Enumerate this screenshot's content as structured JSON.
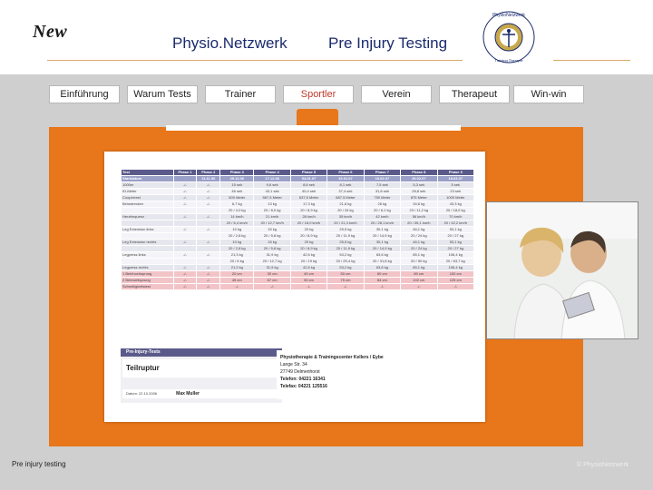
{
  "header": {
    "logo_text": "New",
    "title_left": "Physio.Netzwerk",
    "title_right": "Pre Injury Testing",
    "seal_text": "PhysioNetzwerk Med. Training Therapie"
  },
  "nav": {
    "items": [
      {
        "label": "Einführung",
        "active": false
      },
      {
        "label": "Warum Tests",
        "active": false
      },
      {
        "label": "Trainer",
        "active": false
      },
      {
        "label": "Sportler",
        "active": true
      },
      {
        "label": "Verein",
        "active": false
      },
      {
        "label": "Therapeut",
        "active": false
      },
      {
        "label": "Win-win",
        "active": false
      }
    ]
  },
  "table": {
    "headers": [
      "Test",
      "Phase 1",
      "Phase 2",
      "Phase 3",
      "Phase 4",
      "Phase 5",
      "Phase 6",
      "Phase 7",
      "Phase 8",
      "Phase 9"
    ],
    "rows": [
      {
        "style": "sd",
        "cells": [
          "Startdatum",
          "",
          "11.11.06",
          "29.11.06",
          "17.12.06",
          "04.01.07",
          "23.01.07",
          "10.02.07",
          "28.02.07",
          "18.03.07"
        ]
      },
      {
        "style": "even",
        "cells": [
          "1000er",
          "-/-",
          "-/-",
          "15 sek",
          "9,6 sek",
          "8,6 sek",
          "8,1 sek",
          "7,5 sek",
          "5,3 sek",
          "5 sek"
        ]
      },
      {
        "style": "odd",
        "cells": [
          "ID-Meter",
          "-/-",
          "-/-",
          "46 sek",
          "43,1 sek",
          "40,4 sek",
          "37,4 sek",
          "31,8 sek",
          "28,8 sek",
          "23 sek"
        ]
      },
      {
        "style": "even",
        "cells": [
          "Cooperrest",
          "-/-",
          "-/-",
          "500 Meter",
          "587,5 Meter",
          "637,5 Meter",
          "687,5 Meter",
          "750 Meter",
          "875 Meter",
          "1000 Meter"
        ]
      },
      {
        "style": "odd",
        "cells": [
          "Beinstrecken",
          "-/-",
          "-/-",
          "6,7 kg",
          "13 kg",
          "17,3 kg",
          "21,6 kg",
          "26 kg",
          "34,6 kg",
          "43,3 kg"
        ]
      },
      {
        "style": "odd",
        "cells": [
          "",
          "",
          "",
          "20 / 4,0 kg",
          "20 / 8,0 kg",
          "20 / 8,9 kg",
          "20 / 34 kg",
          "20 / 6,1 kg",
          "23 / 11,2 kg",
          "20 / 18,0 kg"
        ]
      },
      {
        "style": "even",
        "cells": [
          "Herzfrequenz",
          "-/-",
          "-/-",
          "14 km/h",
          "21 km/h",
          "28 km/h",
          "35 km/h",
          "42 km/h",
          "56 km/h",
          "70 km/h"
        ]
      },
      {
        "style": "even",
        "cells": [
          "",
          "",
          "",
          "20 / 6,4 km/h",
          "20 / 12,7 km/h",
          "20 / 18,0 km/h",
          "20 / 21,3 km/h",
          "20 / 28,1 km/h",
          "20 / 35,1 km/h",
          "20 / 42,2 km/h"
        ]
      },
      {
        "style": "odd",
        "cells": [
          "Leg Extension links",
          "-/-",
          "-/-",
          "10 kg",
          "15 kg",
          "20 kg",
          "25,5 kg",
          "30,1 kg",
          "46,1 kg",
          "53,1 kg"
        ]
      },
      {
        "style": "odd",
        "cells": [
          "",
          "",
          "",
          "20 / 2,8 kg",
          "20 / 5,8 kg",
          "20 / 8,9 kg",
          "20 / 11,9 kg",
          "20 / 14,9 kg",
          "20 / 24 kg",
          "20 / 27 kg"
        ]
      },
      {
        "style": "even",
        "cells": [
          "Leg Extension rechts",
          "-/-",
          "-/-",
          "10 kg",
          "15 kg",
          "20 kg",
          "25,5 kg",
          "30,1 kg",
          "46,1 kg",
          "53,1 kg"
        ]
      },
      {
        "style": "even",
        "cells": [
          "",
          "",
          "",
          "20 / 2,8 kg",
          "20 / 5,8 kg",
          "20 / 8,9 kg",
          "20 / 11,9 kg",
          "20 / 14,9 kg",
          "20 / 24 kg",
          "20 / 27 kg"
        ]
      },
      {
        "style": "odd",
        "cells": [
          "Legpress links",
          "-/-",
          "-/-",
          "21,3 kg",
          "31,9 kg",
          "42,6 kg",
          "53,2 kg",
          "63,8 kg",
          "85,1 kg",
          "106,4 kg"
        ]
      },
      {
        "style": "odd",
        "cells": [
          "",
          "",
          "",
          "20 / 6 kg",
          "20 / 12,7 kg",
          "20 / 19 kg",
          "20 / 25,4 kg",
          "20 / 31,8 kg",
          "20 / 50 kg",
          "20 / 63,7 kg"
        ]
      },
      {
        "style": "even",
        "cells": [
          "Legpress rechts",
          "-/-",
          "-/-",
          "21,3 kg",
          "31,9 kg",
          "42,6 kg",
          "53,2 kg",
          "63,8 kg",
          "85,1 kg",
          "106,4 kg"
        ]
      },
      {
        "style": "pink",
        "cells": [
          "1 Beinhochsprung",
          "-/-",
          "-/-",
          "20 cm",
          "30 cm",
          "40 cm",
          "50 cm",
          "60 cm",
          "80 cm",
          "100 cm"
        ]
      },
      {
        "style": "pink",
        "cells": [
          "2 Beinweitsprung",
          "-/-",
          "-/-",
          "45 cm",
          "67 cm",
          "90 cm",
          "75 cm",
          "84 cm",
          "102 cm",
          "125 cm"
        ]
      },
      {
        "style": "pink",
        "cells": [
          "Schnelligkeitstest",
          "-/-",
          "-/-",
          "-/-",
          "-/-",
          "-/-",
          "-/-",
          "-/-",
          "-/-",
          "-/-"
        ]
      }
    ]
  },
  "card": {
    "header": "Pre-Injury-Tests",
    "title": "Teilruptur",
    "date_label": "Datum: 22.10.2006",
    "name": "Max Muller"
  },
  "address": {
    "line1": "Physiotherapie & Trainingscenter Kellers / Eybe",
    "line2": "Lange Str. 34",
    "line3": "27749 Delmenhorst",
    "line4": "Telefon: 04221 16341",
    "line5": "Telefax: 04221 125516"
  },
  "footer": {
    "left": "Pre injury testing",
    "right": "© PhysioNetzwerk"
  },
  "colors": {
    "accent_orange": "#e8761a",
    "title_blue": "#1a2a6c",
    "active_red": "#c0392b",
    "table_header": "#5a5a8a"
  }
}
